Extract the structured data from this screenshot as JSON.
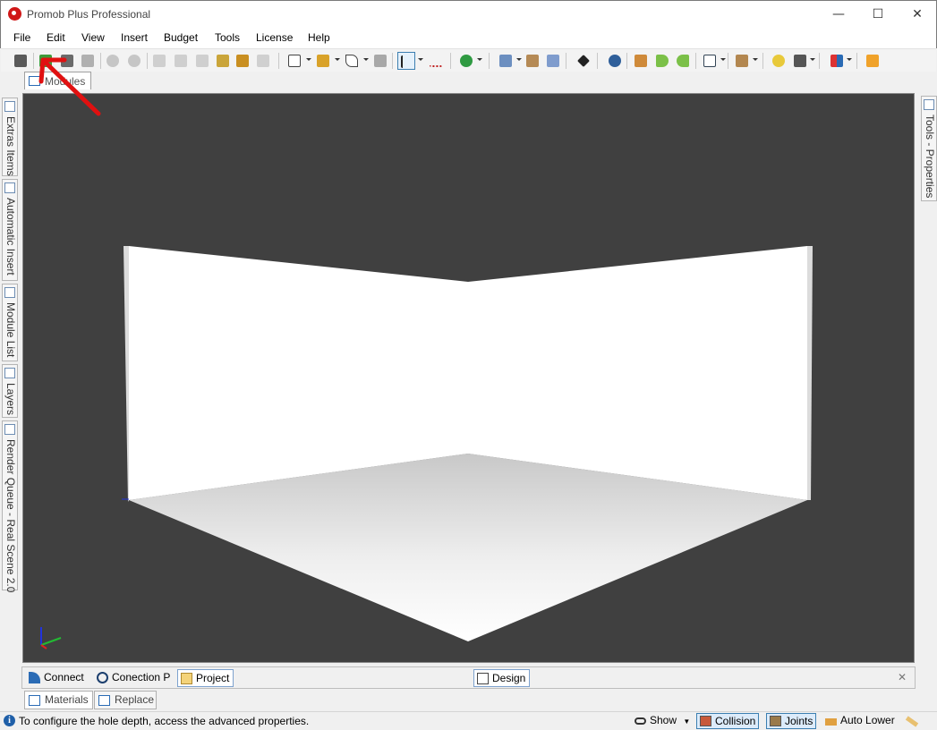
{
  "window": {
    "title": "Promob Plus Professional"
  },
  "menu": [
    "File",
    "Edit",
    "View",
    "Insert",
    "Budget",
    "Tools",
    "License",
    "Help"
  ],
  "doc_tab": {
    "label": "Modules"
  },
  "left_dock": [
    "Extras Items",
    "Automatic Insert",
    "Module List",
    "Layers",
    "Render Queue - Real Scene 2.0"
  ],
  "right_dock": [
    "Tools - Properties"
  ],
  "bottom_tabs": [
    "Connect",
    "Conection P",
    "Project",
    "Design"
  ],
  "sub_tabs": [
    "Materials",
    "Replace"
  ],
  "status": {
    "message": "To configure the hole depth, access the advanced properties.",
    "show_label": "Show",
    "collision_label": "Collision",
    "joints_label": "Joints",
    "auto_lower_label": "Auto Lower"
  },
  "colors": {
    "viewport_bg": "#404040",
    "annotation_arrow": "#e01010",
    "accent": "#3c7fb1"
  }
}
